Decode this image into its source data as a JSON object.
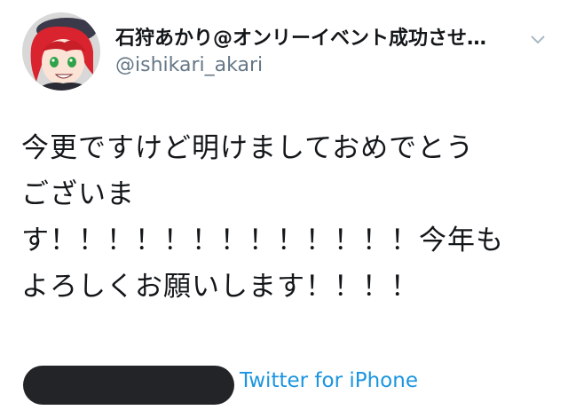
{
  "user": {
    "display_name": "石狩あかり@オンリーイベント成功させ…",
    "handle": "@ishikari_akari",
    "avatar_icon": "anime-avatar-icon"
  },
  "menu": {
    "icon": "chevron-down-icon"
  },
  "tweet": {
    "lines": [
      "今更ですけど明けましておめでとう",
      "ございま",
      "す！！！！！！！！！！！！！今年も",
      "よろしくお願いします！！！！"
    ]
  },
  "footer": {
    "source_label": "Twitter for iPhone"
  },
  "colors": {
    "link": "#1b95e0",
    "secondary_text": "#657786",
    "primary_text": "#14171a",
    "redaction": "#222427"
  }
}
